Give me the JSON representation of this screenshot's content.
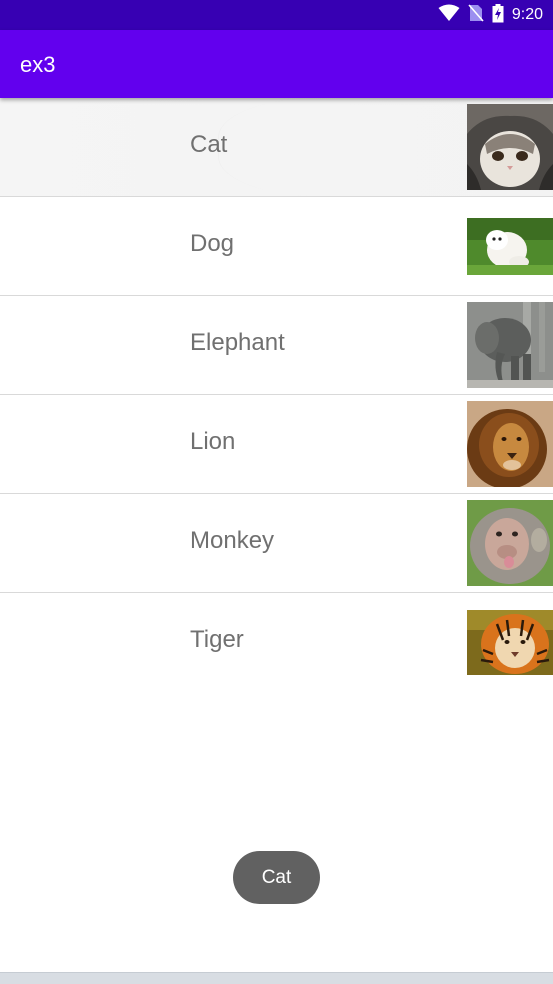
{
  "status_bar": {
    "time": "9:20",
    "icons": [
      "wifi-icon",
      "no-sim-icon",
      "battery-charging-icon"
    ]
  },
  "app_bar": {
    "title": "ex3"
  },
  "list": {
    "items": [
      {
        "label": "Cat",
        "image": "cat-photo"
      },
      {
        "label": "Dog",
        "image": "dog-photo"
      },
      {
        "label": "Elephant",
        "image": "elephant-photo"
      },
      {
        "label": "Lion",
        "image": "lion-photo"
      },
      {
        "label": "Monkey",
        "image": "monkey-photo"
      },
      {
        "label": "Tiger",
        "image": "tiger-photo"
      }
    ]
  },
  "toast": {
    "text": "Cat"
  },
  "colors": {
    "status_bar": "#3700b3",
    "app_bar": "#6200ee",
    "item_text": "#707070",
    "toast_bg": "#616161"
  }
}
